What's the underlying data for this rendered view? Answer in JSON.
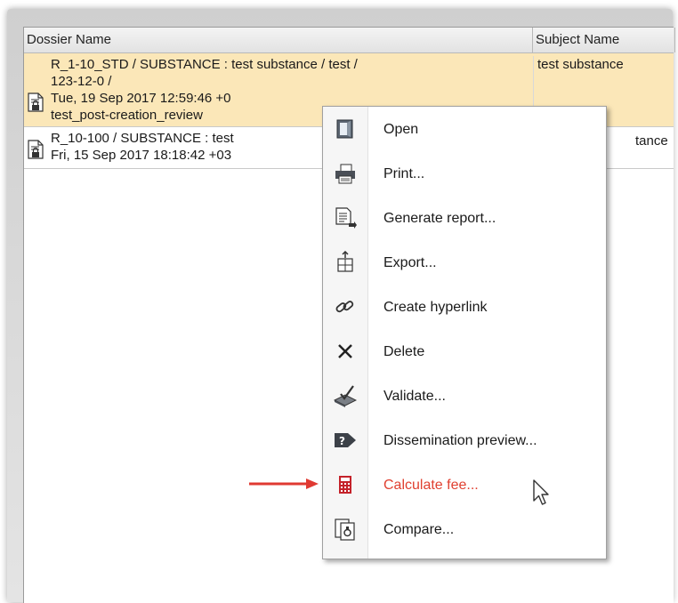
{
  "table": {
    "columns": [
      "Dossier Name",
      "Subject Name"
    ],
    "rows": [
      {
        "lines": [
          "R_1-10_STD / SUBSTANCE : test substance / test /",
          "123-12-0 /",
          "Tue, 19 Sep 2017 12:59:46 +0",
          "test_post-creation_review"
        ],
        "subject": "test substance",
        "selected": true
      },
      {
        "lines": [
          "R_10-100 / SUBSTANCE : test",
          "Fri, 15 Sep 2017 18:18:42 +03"
        ],
        "subject": "tance",
        "selected": false
      }
    ]
  },
  "context_menu": {
    "items": [
      {
        "label": "Open",
        "icon": "open-icon"
      },
      {
        "label": "Print...",
        "icon": "printer-icon"
      },
      {
        "label": "Generate report...",
        "icon": "report-icon"
      },
      {
        "label": "Export...",
        "icon": "export-icon"
      },
      {
        "label": "Create hyperlink",
        "icon": "hyperlink-icon"
      },
      {
        "label": "Delete",
        "icon": "delete-icon"
      },
      {
        "label": "Validate...",
        "icon": "validate-icon"
      },
      {
        "label": "Dissemination preview...",
        "icon": "dissemination-icon"
      },
      {
        "label": "Calculate fee...",
        "icon": "calculator-icon",
        "highlighted": true
      },
      {
        "label": "Compare...",
        "icon": "compare-icon"
      }
    ]
  },
  "colors": {
    "selected_row": "#fbe7b8",
    "highlight_text": "#e04030",
    "arrow": "#e03a32"
  }
}
